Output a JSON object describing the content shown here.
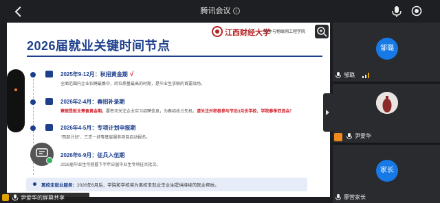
{
  "app": {
    "title": "腾讯会议"
  },
  "slide": {
    "title": "2026届就业关键时间节点",
    "logo": {
      "university": "江西财经大学",
      "department": "软件与物联网工程学院"
    },
    "items": [
      {
        "head": "2025年9-12月：秋招黄金期",
        "check": "√",
        "desc": "全面范围内企业招聘最集中，岗位质量最高的时期，是毕业生求职的首要战场。",
        "desc_red": ""
      },
      {
        "head": "2026年2-4月：春招补录期",
        "check": "",
        "desc_red": "寒假是就业筹备黄金期，",
        "desc": "要密切关注企业实习招聘信息，为春招抢占先机。",
        "desc_red2": "请关注并积极参与节后3月份学校、学院春季双选会！"
      },
      {
        "head": "2026年4-5月：专项计划申报期",
        "check": "",
        "desc": "\"西部计划\"、三支一扶等基层服务项目启动报名。",
        "desc_red": ""
      },
      {
        "head": "2026年6-9月：征兵入伍期",
        "check": "",
        "desc": "2026届毕业生可把握下半年应届毕业生专项征兵批次。",
        "desc_red": ""
      }
    ],
    "note_label": "离校未就业服务：",
    "note_text": "2026年6月后，学院和学校将为离校未就业毕业生提供持续的就业帮扶。"
  },
  "share_bar": {
    "text": "尹爱华的屏幕共享"
  },
  "participants": [
    {
      "avatar": "邹璐",
      "name": "邹璐",
      "avatar_color": "#1679e6"
    },
    {
      "avatar": "",
      "name": "尹爱华",
      "avatar_color": "#e5e0dd"
    },
    {
      "avatar": "家长",
      "name": "廖营家长",
      "avatar_color": "#1679e6"
    }
  ]
}
